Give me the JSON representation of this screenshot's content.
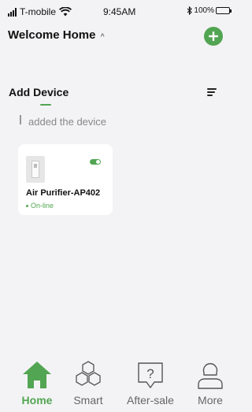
{
  "status_bar": {
    "carrier": "T-mobile",
    "time": "9:45AM",
    "battery": "100%",
    "icons": [
      "signal-icon",
      "wifi-icon",
      "bluetooth-icon",
      "battery-icon"
    ]
  },
  "header": {
    "title": "Welcome Home",
    "caret": "^",
    "add_icon": "plus-icon"
  },
  "section": {
    "title": "Add Device",
    "sort_icon": "sort-icon",
    "subtitle": "added the device"
  },
  "devices": [
    {
      "name": "Air Purifier-AP402",
      "status": "On-line",
      "power_on": true,
      "image": "air-purifier-image"
    }
  ],
  "nav": {
    "items": [
      {
        "label": "Home",
        "icon": "home-icon",
        "active": true
      },
      {
        "label": "Smart",
        "icon": "hexagon-cluster-icon",
        "active": false
      },
      {
        "label": "After-sale",
        "icon": "question-chat-icon",
        "active": false
      },
      {
        "label": "More",
        "icon": "person-icon",
        "active": false
      }
    ]
  },
  "colors": {
    "accent": "#52a552",
    "background": "#f3f3f5",
    "card": "#ffffff",
    "muted_text": "#888888"
  }
}
